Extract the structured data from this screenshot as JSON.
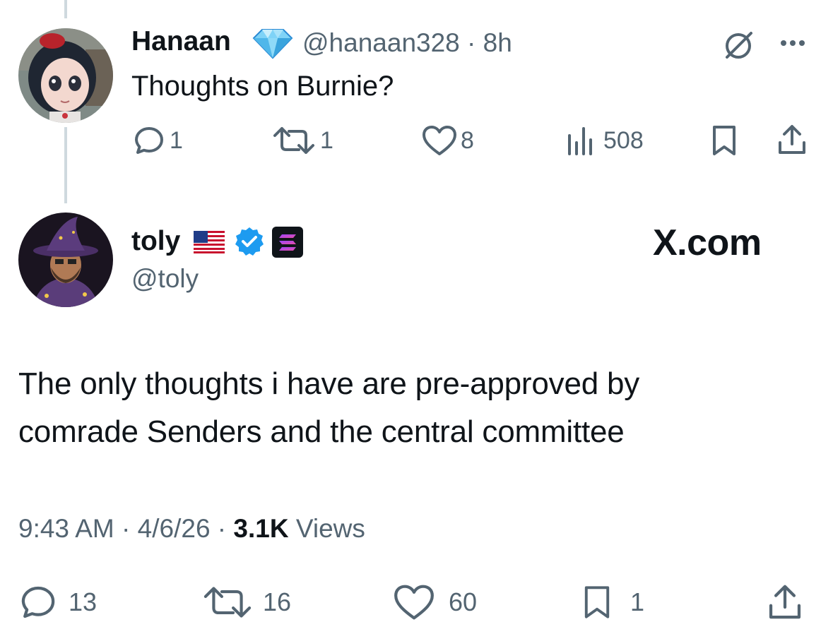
{
  "tweet": {
    "author": {
      "name": "Hanaan",
      "handle": "@hanaan328",
      "time": "8h",
      "badge_icon": "diamond-icon"
    },
    "text": "Thoughts on Burnie?",
    "stats": {
      "replies": "1",
      "reposts": "1",
      "likes": "8",
      "views": "508"
    }
  },
  "reply": {
    "author": {
      "name": "toly",
      "handle": "@toly",
      "flag_icon": "us-flag-icon",
      "verified_icon": "verified-badge-icon",
      "affiliation_icon": "solana-logo-icon"
    },
    "watermark": "X.com",
    "text_lines": [
      "The only thoughts i have are pre-approved by",
      "comrade Senders and the central committee"
    ],
    "time": "9:43 AM",
    "date": "4/6/26",
    "views_count": "3.1K",
    "views_label": "Views",
    "stats": {
      "replies": "13",
      "reposts": "16",
      "likes": "60",
      "bookmarks": "1"
    }
  },
  "colors": {
    "text": "#0f1419",
    "muted": "#536471",
    "thread_line": "#cfd9de",
    "verified": "#1d9bf0"
  }
}
